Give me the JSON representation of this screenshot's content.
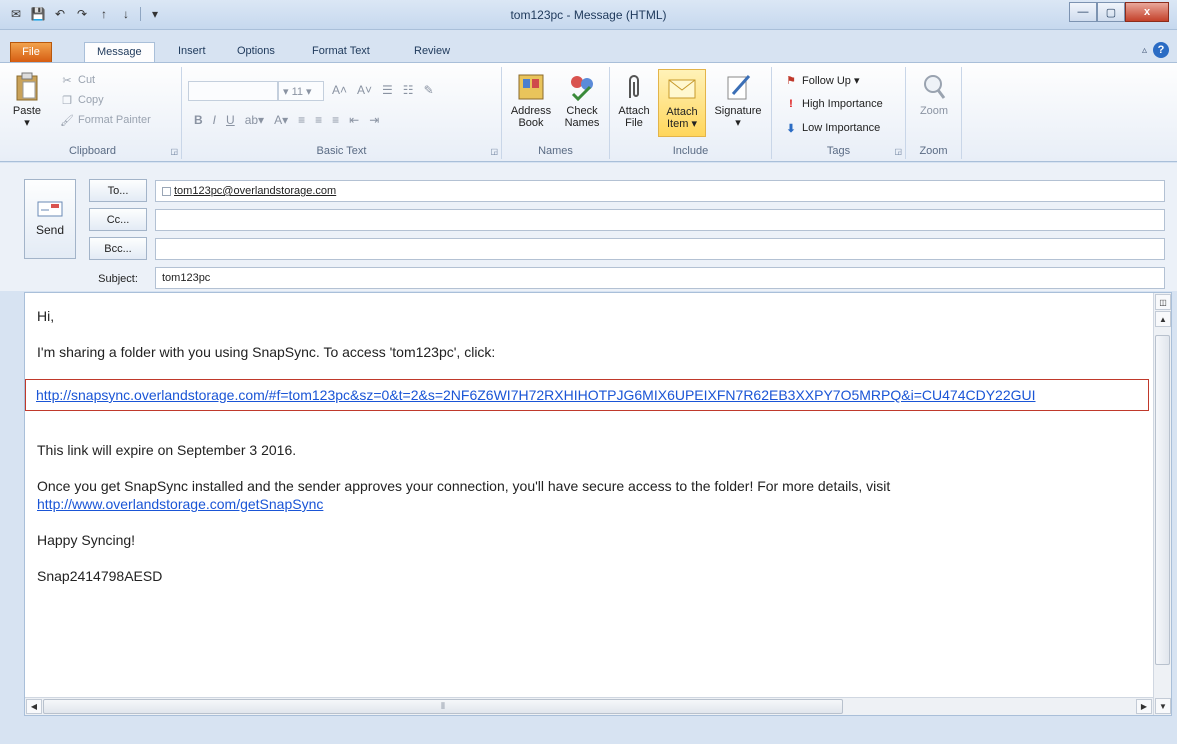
{
  "window": {
    "title": "tom123pc  -  Message (HTML)",
    "controls": {
      "minimize": "—",
      "maximize": "▢",
      "close": "x"
    }
  },
  "quick_access": [
    "save-icon",
    "undo-icon",
    "redo-icon",
    "up-icon",
    "down-icon",
    "customize-icon"
  ],
  "tabs": [
    "File",
    "Message",
    "Insert",
    "Options",
    "Format Text",
    "Review"
  ],
  "active_tab": "Message",
  "ribbon": {
    "clipboard": {
      "label": "Clipboard",
      "paste": "Paste",
      "cut": "Cut",
      "copy": "Copy",
      "format_painter": "Format Painter"
    },
    "basic_text": {
      "label": "Basic Text",
      "font_size": "11",
      "bold": "B",
      "italic": "I",
      "underline": "U"
    },
    "names": {
      "label": "Names",
      "address_book_l1": "Address",
      "address_book_l2": "Book",
      "check_names_l1": "Check",
      "check_names_l2": "Names"
    },
    "include": {
      "label": "Include",
      "attach_file_l1": "Attach",
      "attach_file_l2": "File",
      "attach_item_l1": "Attach",
      "attach_item_l2": "Item ▾",
      "signature": "Signature"
    },
    "tags": {
      "label": "Tags",
      "follow_up": "Follow Up ▾",
      "high_importance": "High Importance",
      "low_importance": "Low Importance"
    },
    "zoom": {
      "label": "Zoom",
      "zoom_btn": "Zoom"
    }
  },
  "compose": {
    "send": "Send",
    "to_btn": "To...",
    "cc_btn": "Cc...",
    "bcc_btn": "Bcc...",
    "subject_label": "Subject:",
    "to_value": "tom123pc@overlandstorage.com",
    "cc_value": "",
    "bcc_value": "",
    "subject_value": "tom123pc"
  },
  "body": {
    "greeting": "Hi,",
    "intro": "I'm sharing a folder with you using SnapSync. To access 'tom123pc', click:",
    "share_link": "http://snapsync.overlandstorage.com/#f=tom123pc&sz=0&t=2&s=2NF6Z6WI7H72RXHIHOTPJG6MIX6UPEIXFN7R62EB3XXPY7O5MRPQ&i=CU474CDY22GUI",
    "expire": "This link will expire on September 3 2016.",
    "details": "Once you get SnapSync installed and the sender approves your connection, you'll have secure access to the folder! For more details, visit",
    "details_link": "http://www.overlandstorage.com/getSnapSync",
    "closing": "Happy Syncing!",
    "signature": "Snap2414798AESD"
  },
  "colors": {
    "accent": "#2b6cc4",
    "file_tab": "#d65d12",
    "link": "#1a55d6",
    "highlight_box": "#c0392b"
  }
}
